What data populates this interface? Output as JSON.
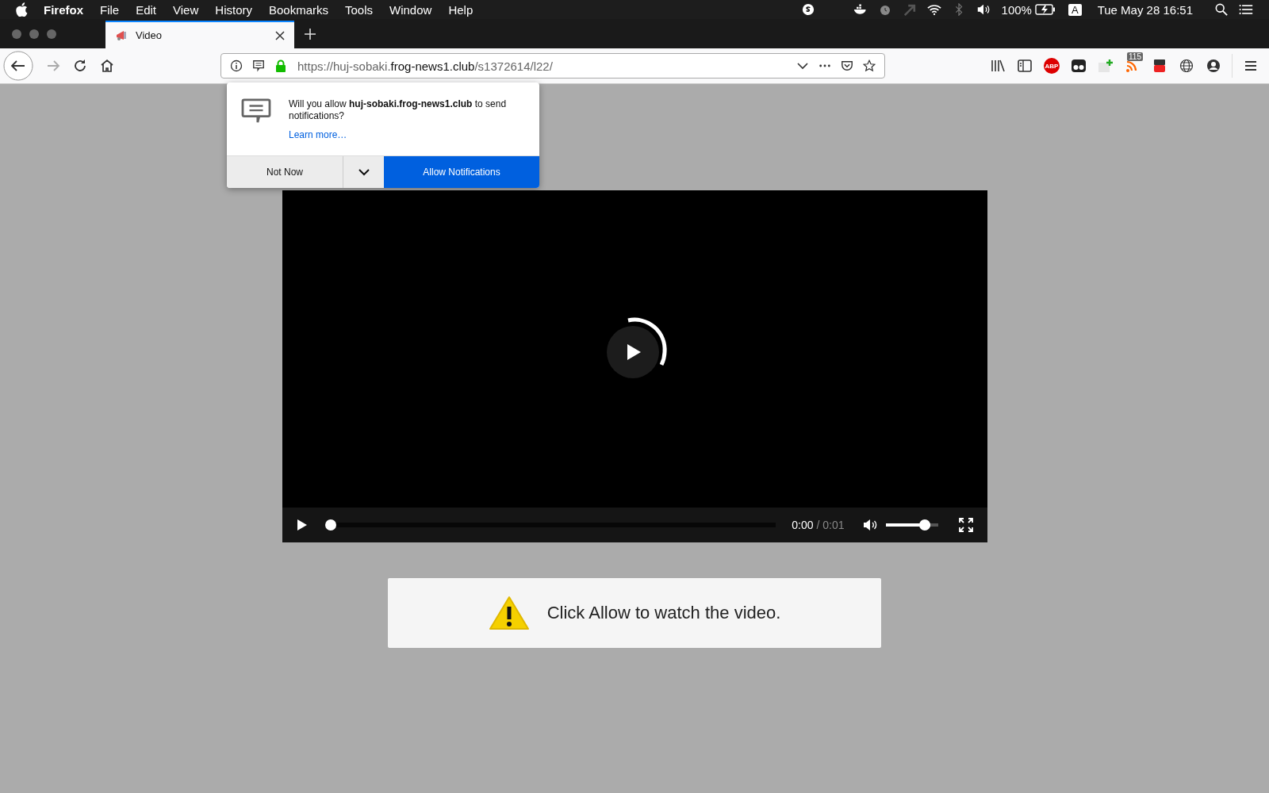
{
  "menu_bar": {
    "app": "Firefox",
    "items": [
      "File",
      "Edit",
      "View",
      "History",
      "Bookmarks",
      "Tools",
      "Window",
      "Help"
    ],
    "battery": "100%",
    "input_source": "A",
    "clock": "Tue May 28  16:51"
  },
  "tabs": [
    {
      "title": "Video",
      "selected": true
    }
  ],
  "address_bar": {
    "url_start": "https://huj-sobaki.",
    "url_domain": "frog-news1.club",
    "url_path": "/s1372614/l22/"
  },
  "toolbar": {
    "adblock_label": "ABP",
    "feed_badge": "115"
  },
  "notification_popup": {
    "message": "Will you allow **huj-sobaki.frog-news1.club** to send notifications?",
    "link": "Learn more…",
    "secondary_button": "Not Now",
    "primary_button": "Allow Notifications"
  },
  "video": {
    "current_time": "0:00",
    "duration": "/ 0:01",
    "progress": {
      "level": 0
    },
    "volume": {
      "level": 0.85
    }
  },
  "notice": {
    "text": "Click Allow to watch the video."
  }
}
